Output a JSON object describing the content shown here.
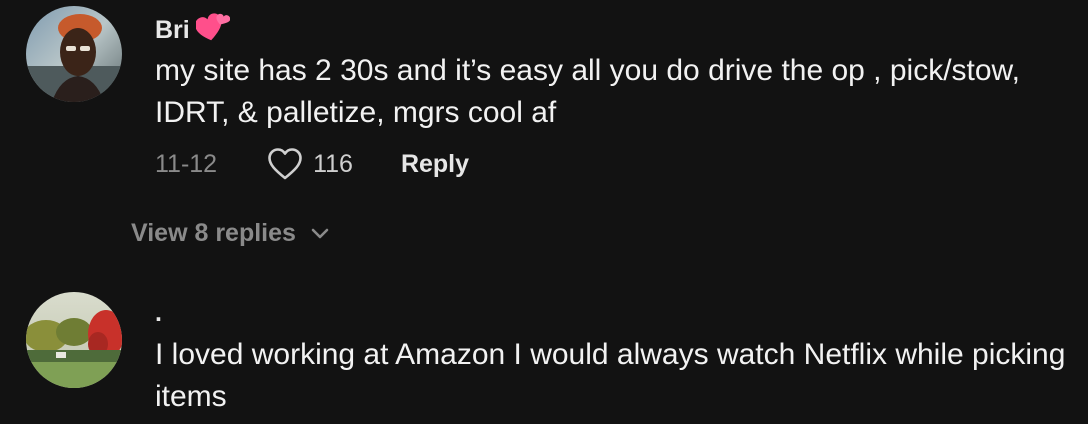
{
  "comments": [
    {
      "username": "Bri",
      "username_emoji": "two-hearts-emoji",
      "text": "my site has 2 30s and it’s easy all you do drive the op , pick/stow, IDRT, & palletize, mgrs cool af",
      "date": "11-12",
      "likes": "116",
      "reply_label": "Reply",
      "view_replies_label": "View 8 replies"
    },
    {
      "username": ".",
      "text": "I loved working at Amazon I would always watch Netflix while picking items"
    }
  ],
  "icons": {
    "like": "heart-outline-icon",
    "expand": "chevron-down-icon"
  },
  "colors": {
    "background": "#121212",
    "text_primary": "#f2f2f2",
    "text_secondary": "#8a8a8a",
    "emoji_pink": "#ff4f8b"
  }
}
